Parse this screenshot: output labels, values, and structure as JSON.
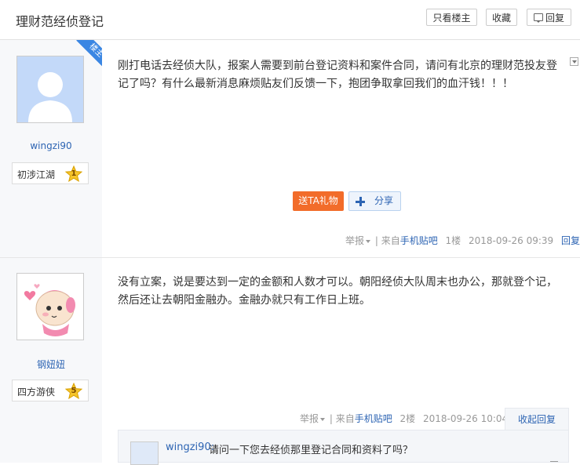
{
  "header": {
    "title": "理财范经侦登记",
    "only_op_label": "只看楼主",
    "favorite_label": "收藏",
    "reply_label": "回复"
  },
  "posts": [
    {
      "username": "wingzi90",
      "level_name": "初涉江湖",
      "level_num": "1",
      "op_badge": "楼主",
      "content": "刚打电话去经侦大队，报案人需要到前台登记资料和案件合同，请问有北京的理财范投友登记了吗？有什么最新消息麻烦贴友们反馈一下，抱团争取拿回我们的血汗钱！！！",
      "gift_label": "送TA礼物",
      "share_label": "分享",
      "report_label": "举报",
      "source_prefix": "| 来自",
      "source_link": "手机贴吧",
      "floor": "1楼",
      "time": "2018-09-26 09:39",
      "reply_label": "回复"
    },
    {
      "username": "钢妞妞",
      "level_name": "四方游侠",
      "level_num": "5",
      "content": "没有立案，说是要达到一定的金额和人数才可以。朝阳经侦大队周末也办公，那就登个记，然后还让去朝阳金融办。金融办就只有工作日上班。",
      "report_label": "举报",
      "source_prefix": "| 来自",
      "source_link": "手机贴吧",
      "floor": "2楼",
      "time": "2018-09-26 10:04",
      "collapse_label": "收起回复",
      "sub_reply": {
        "username": "wingzi90:",
        "text": "请问一下您去经侦那里登记合同和资料了吗？"
      }
    }
  ],
  "colors": {
    "link": "#2d64b3",
    "gift": "#f26c2a",
    "op_badge": "#3a86e3",
    "sidebar": "#f7f8fa"
  },
  "icons": [
    "reply-icon",
    "avatar-default-icon",
    "avatar-cartoon-icon",
    "star-level-icon",
    "share-plus-icon",
    "dropdown-triangle-icon",
    "collapse-arrow-icon"
  ]
}
